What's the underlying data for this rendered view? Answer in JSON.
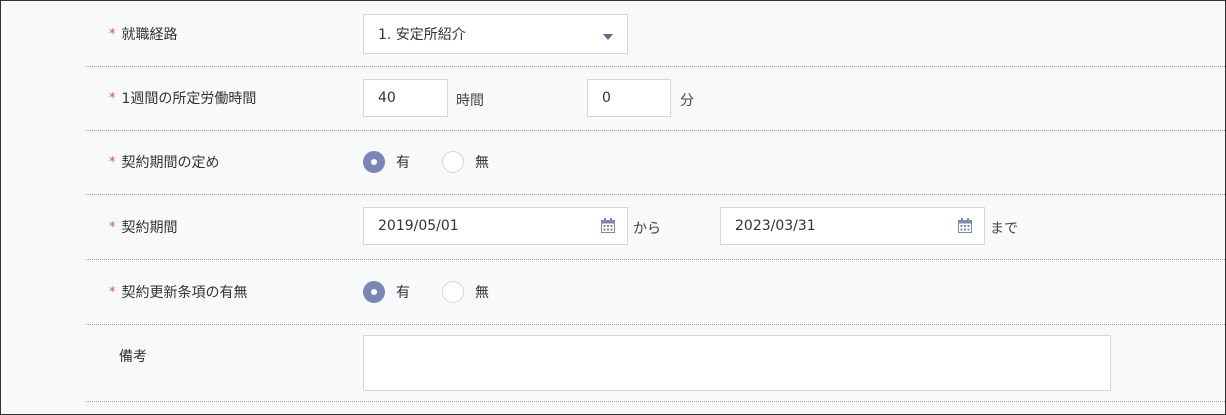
{
  "form": {
    "route": {
      "required_mark": "*",
      "label": "就職経路",
      "selected": "1. 安定所紹介"
    },
    "weekly_hours": {
      "required_mark": "*",
      "label": "1週間の所定労働時間",
      "hours_value": "40",
      "hours_unit": "時間",
      "minutes_value": "0",
      "minutes_unit": "分"
    },
    "contract_term_defined": {
      "required_mark": "*",
      "label": "契約期間の定め",
      "options": [
        "有",
        "無"
      ],
      "selected": "有"
    },
    "contract_period": {
      "required_mark": "*",
      "label": "契約期間",
      "start_date": "2019/05/01",
      "from_text": "から",
      "end_date": "2023/03/31",
      "until_text": "まで"
    },
    "renewal_clause": {
      "required_mark": "*",
      "label": "契約更新条項の有無",
      "options": [
        "有",
        "無"
      ],
      "selected": "有"
    },
    "remarks": {
      "label": "備考",
      "value": ""
    }
  },
  "icons": {
    "dropdown": "chevron-down-icon",
    "calendar": "calendar-icon"
  },
  "colors": {
    "required": "#d9534f",
    "radio_selected": "#7a86b3",
    "dropdown_caret": "#5a6b90"
  }
}
